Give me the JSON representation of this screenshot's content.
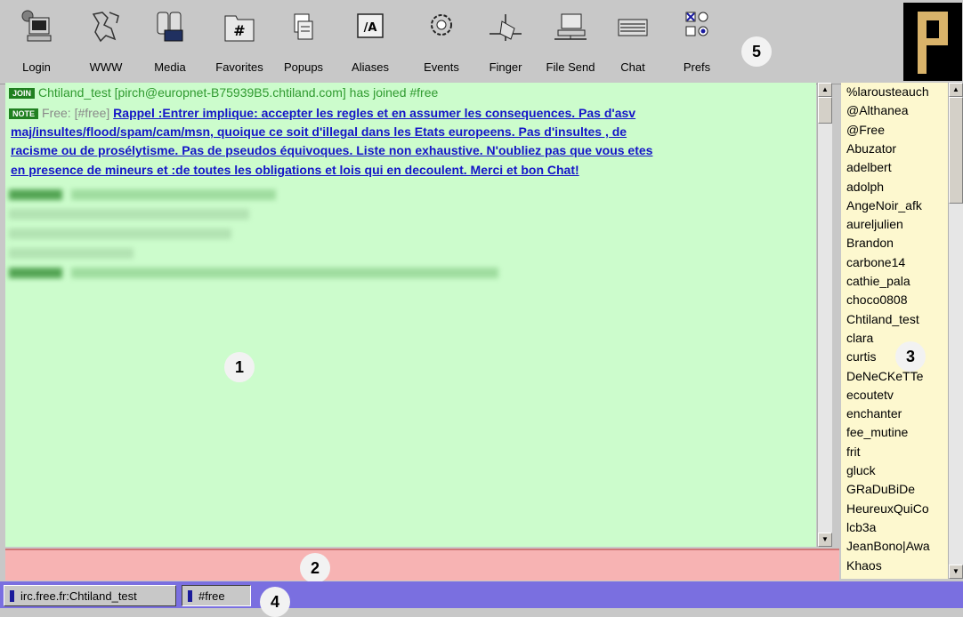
{
  "toolbar": {
    "buttons": [
      {
        "label": "Login",
        "icon": "login-icon"
      },
      {
        "label": "WWW",
        "icon": "www-icon"
      },
      {
        "label": "Media",
        "icon": "media-icon"
      },
      {
        "label": "Favorites",
        "icon": "favorites-icon"
      },
      {
        "label": "Popups",
        "icon": "popups-icon"
      },
      {
        "label": "Aliases",
        "icon": "aliases-icon"
      },
      {
        "label": "Events",
        "icon": "events-icon"
      },
      {
        "label": "Finger",
        "icon": "finger-icon"
      },
      {
        "label": "File Send",
        "icon": "file-send-icon"
      },
      {
        "label": "Chat",
        "icon": "chat-icon"
      },
      {
        "label": "Prefs",
        "icon": "prefs-icon"
      }
    ],
    "favorites_glyph": "#",
    "aliases_glyph": "/A"
  },
  "badges": {
    "b1": "1",
    "b2": "2",
    "b3": "3",
    "b4": "4",
    "b5": "5"
  },
  "chat": {
    "join_tag": "JOIN",
    "join_text": "Chtiland_test [pirch@europnet-B75939B5.chtiland.com] has joined #free",
    "note_tag": "NOTE",
    "note_prefix": "Free: [#free]",
    "notice_line1": "Rappel :Entrer implique: accepter les regles et en assumer les consequences. Pas d'asv",
    "notice_line2": "maj/insultes/flood/spam/cam/msn, quoique ce soit d'illegal dans les Etats europeens. Pas d'insultes , de",
    "notice_line3": "racisme ou de prosélytisme. Pas de pseudos équivoques. Liste non exhaustive. N'oubliez pas que vous etes",
    "notice_line4": "en presence de mineurs et :de toutes les obligations et lois qui en decoulent. Merci et bon Chat!"
  },
  "nicklist": [
    "%larousteauch",
    "@Althanea",
    "@Free",
    "Abuzator",
    "adelbert",
    "adolph",
    "AngeNoir_afk",
    "aureljulien",
    "Brandon",
    "carbone14",
    "cathie_pala",
    "choco0808",
    "Chtiland_test",
    "clara",
    "curtis",
    "DeNeCKeTTe",
    "ecoutetv",
    "enchanter",
    "fee_mutine",
    "frit",
    "gluck",
    "GRaDuBiDe",
    "HeureuxQuiCo",
    "lcb3a",
    "JeanBono|Awa",
    "Khaos"
  ],
  "switchbar": {
    "server": "irc.free.fr:Chtiland_test",
    "channel": "#free"
  },
  "colors": {
    "chat_bg": "#ccfccc",
    "input_bg": "#f7b3b3",
    "nick_bg": "#fdf8cf",
    "switchbar_bg": "#7a6fe0"
  }
}
